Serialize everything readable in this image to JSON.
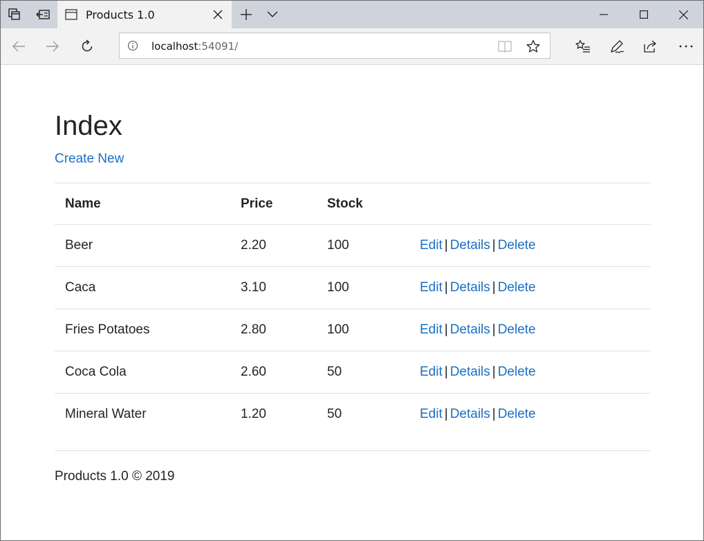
{
  "browser": {
    "tab_title": "Products 1.0",
    "address_host": "localhost",
    "address_rest": ":54091/"
  },
  "page": {
    "heading": "Index",
    "create_link": "Create New",
    "table": {
      "headers": [
        "Name",
        "Price",
        "Stock"
      ],
      "rows": [
        {
          "name": "Beer",
          "price": "2.20",
          "stock": "100"
        },
        {
          "name": "Caca",
          "price": "3.10",
          "stock": "100"
        },
        {
          "name": "Fries Potatoes",
          "price": "2.80",
          "stock": "100"
        },
        {
          "name": "Coca Cola",
          "price": "2.60",
          "stock": "50"
        },
        {
          "name": "Mineral Water",
          "price": "1.20",
          "stock": "50"
        }
      ],
      "actions": {
        "edit": "Edit",
        "details": "Details",
        "delete": "Delete",
        "separator": "|"
      }
    },
    "footer": "Products 1.0 © 2019"
  },
  "colors": {
    "link": "#1b6ec2",
    "text": "#212529",
    "tabstrip": "#cfd3dc",
    "toolbar": "#f2f2f2"
  }
}
